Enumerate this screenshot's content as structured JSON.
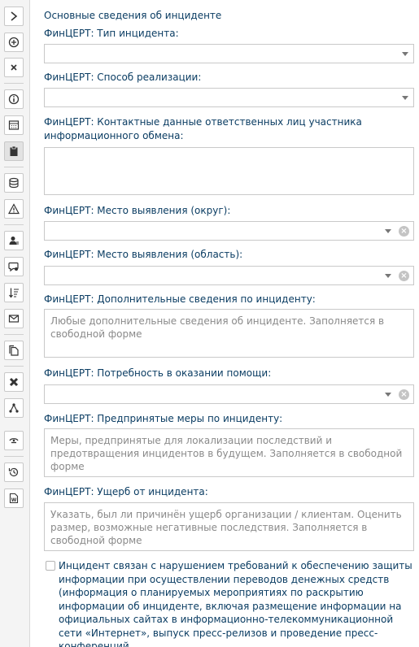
{
  "toolbar": {
    "buttons": [
      {
        "name": "expand-icon"
      },
      {
        "name": "add-icon"
      },
      {
        "name": "close-icon"
      },
      {
        "name": "info-icon"
      },
      {
        "name": "calendar-grid-icon"
      },
      {
        "name": "clipboard-icon"
      },
      {
        "name": "database-icon"
      },
      {
        "name": "warning-icon"
      },
      {
        "name": "user-card-icon"
      },
      {
        "name": "comment-search-icon"
      },
      {
        "name": "sort-icon"
      },
      {
        "name": "mail-icon"
      },
      {
        "name": "copy-icon"
      },
      {
        "name": "puzzle-icon"
      },
      {
        "name": "network-icon"
      },
      {
        "name": "link-icon"
      },
      {
        "name": "history-icon"
      },
      {
        "name": "word-document-icon"
      }
    ]
  },
  "form": {
    "section_title": "Основные сведения об инциденте",
    "incident_type": {
      "label": "ФинЦЕРТ: Тип инцидента:",
      "value": ""
    },
    "implementation_method": {
      "label": "ФинЦЕРТ: Способ реализации:",
      "value": ""
    },
    "contacts": {
      "label": "ФинЦЕРТ: Контактные данные ответственных лиц участника информационного обмена:",
      "value": ""
    },
    "location_district": {
      "label": "ФинЦЕРТ: Место выявления (округ):",
      "value": ""
    },
    "location_region": {
      "label": "ФинЦЕРТ: Место выявления (область):",
      "value": ""
    },
    "additional_info": {
      "label": "ФинЦЕРТ: Дополнительные сведения по инциденту:",
      "placeholder": "Любые дополнительные сведения об инциденте. Заполняется в свободной форме"
    },
    "help_needed": {
      "label": "ФинЦЕРТ: Потребность в оказании помощи:",
      "value": ""
    },
    "measures": {
      "label": "ФинЦЕРТ: Предпринятые меры по инциденту:",
      "placeholder": "Меры, предпринятые для локализации последствий и предотвращения инцидентов в будущем. Заполняется в свободной форме"
    },
    "damage": {
      "label": "ФинЦЕРТ: Ущерб от инцидента:",
      "placeholder": "Указать, был ли причинён ущерб организации / клиентам. Оценить размер, возможные негативные последствия. Заполняется в свободной форме"
    },
    "violation_checkbox": {
      "checked": false,
      "label": "Инцидент связан с нарушением требований к обеспечению защиты информации при осуществлении переводов денежных средств (информация о планируемых мероприятиях по раскрытию информации об инциденте, включая размещение информации на официальных сайтах в информационно-телекоммуникационной сети «Интернет», выпуск пресс-релизов и проведение пресс-конференций"
    }
  }
}
